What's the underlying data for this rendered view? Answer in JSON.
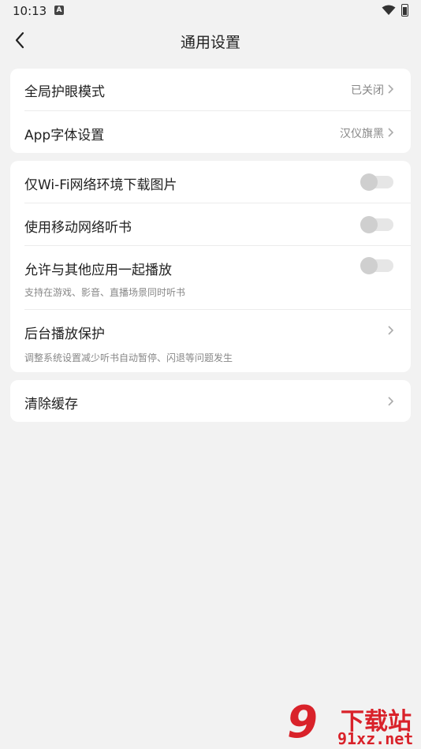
{
  "status_bar": {
    "time": "10:13",
    "notification_letter": "A"
  },
  "header": {
    "title": "通用设置"
  },
  "section1": {
    "eye_mode": {
      "label": "全局护眼模式",
      "value": "已关闭"
    },
    "font": {
      "label": "App字体设置",
      "value": "汉仪旗黑"
    }
  },
  "section2": {
    "wifi_only": {
      "label": "仅Wi-Fi网络环境下载图片",
      "enabled": false
    },
    "mobile_network": {
      "label": "使用移动网络听书",
      "enabled": false
    },
    "mix_play": {
      "label": "允许与其他应用一起播放",
      "sub": "支持在游戏、影音、直播场景同时听书",
      "enabled": false
    },
    "background_protect": {
      "label": "后台播放保护",
      "sub": "调整系统设置减少听书自动暂停、闪退等问题发生"
    }
  },
  "section3": {
    "clear_cache": {
      "label": "清除缓存"
    }
  },
  "watermark": {
    "title": "下载站",
    "url": "91xz.net"
  },
  "colors": {
    "background": "#f2f2f2",
    "card": "#ffffff",
    "watermark_red": "#d9222a"
  }
}
